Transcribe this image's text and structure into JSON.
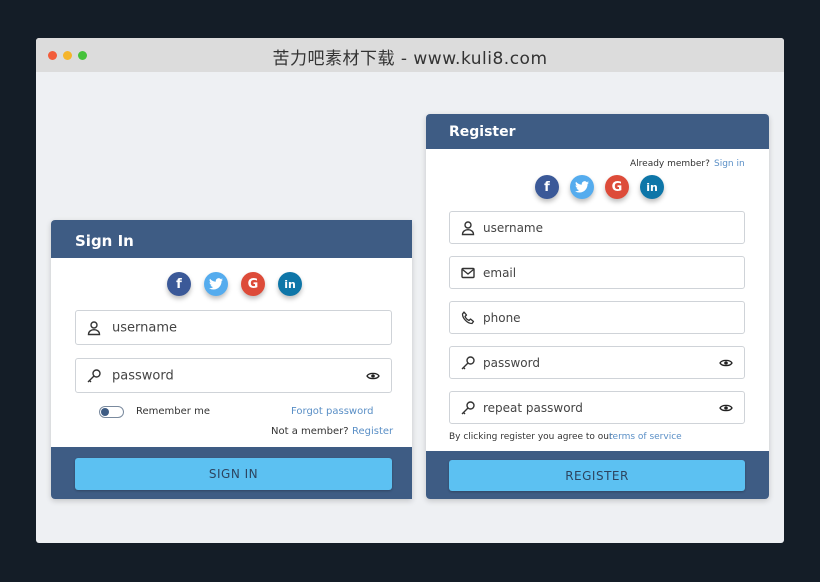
{
  "window": {
    "title": "苦力吧素材下载 - www.kuli8.com"
  },
  "signin": {
    "title": "Sign In",
    "username_placeholder": "username",
    "password_placeholder": "password",
    "remember_label": "Remember me",
    "forgot_label": "Forgot password",
    "not_member_text": "Not a member?",
    "register_link": "Register",
    "submit_label": "SIGN IN"
  },
  "register": {
    "title": "Register",
    "already_member_text": "Already member?",
    "signin_link": "Sign in",
    "username_placeholder": "username",
    "email_placeholder": "email",
    "phone_placeholder": "phone",
    "password_placeholder": "password",
    "repeat_password_placeholder": "repeat password",
    "terms_prefix": "By clicking register you agree to our",
    "terms_link": "terms of service",
    "submit_label": "REGISTER"
  },
  "socials": {
    "facebook": "f",
    "google": "G",
    "linkedin": "in"
  },
  "colors": {
    "header": "#3e5c84",
    "button": "#5cc1f2",
    "link": "#5a8fc6",
    "background": "#141d27"
  },
  "icons": [
    "user-icon",
    "key-icon",
    "mail-icon",
    "phone-icon",
    "eye-icon",
    "facebook-icon",
    "twitter-icon",
    "google-icon",
    "linkedin-icon"
  ]
}
